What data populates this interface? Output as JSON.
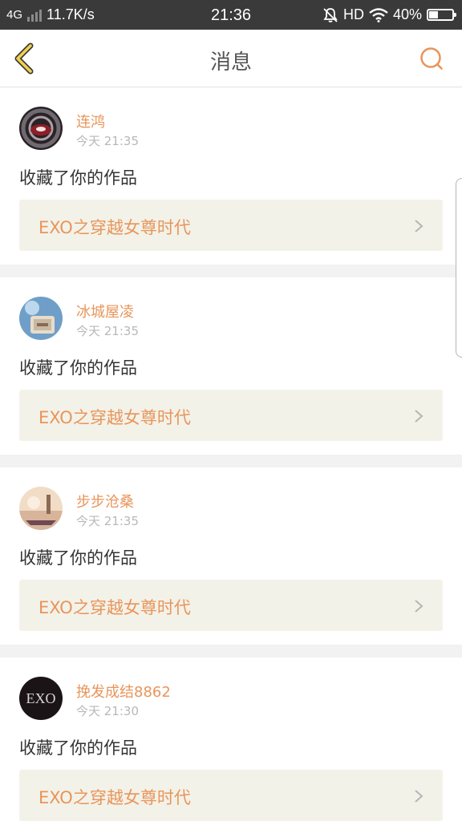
{
  "status_bar": {
    "network": "4G",
    "speed": "11.7K/s",
    "time": "21:36",
    "hd": "HD",
    "battery_percent": "40%",
    "battery_level": 0.4
  },
  "header": {
    "title": "消息",
    "back_icon": "chevron-left-icon",
    "search_icon": "search-icon"
  },
  "colors": {
    "accent": "#e8955a",
    "back_accent": "#f2d14d",
    "status_bg": "#3a3a3a",
    "card_bg": "#ffffff",
    "link_bg": "#f3f2e9"
  },
  "messages": [
    {
      "user": "连鸿",
      "time": "今天 21:35",
      "text": "收藏了你的作品",
      "work": "EXO之穿越女尊时代"
    },
    {
      "user": "冰城屋凌",
      "time": "今天 21:35",
      "text": "收藏了你的作品",
      "work": "EXO之穿越女尊时代"
    },
    {
      "user": "步步沧桑",
      "time": "今天 21:35",
      "text": "收藏了你的作品",
      "work": "EXO之穿越女尊时代"
    },
    {
      "user": "挽发成结8862",
      "time": "今天 21:30",
      "text": "收藏了你的作品",
      "work": "EXO之穿越女尊时代",
      "avatar_text": "EXO"
    }
  ]
}
